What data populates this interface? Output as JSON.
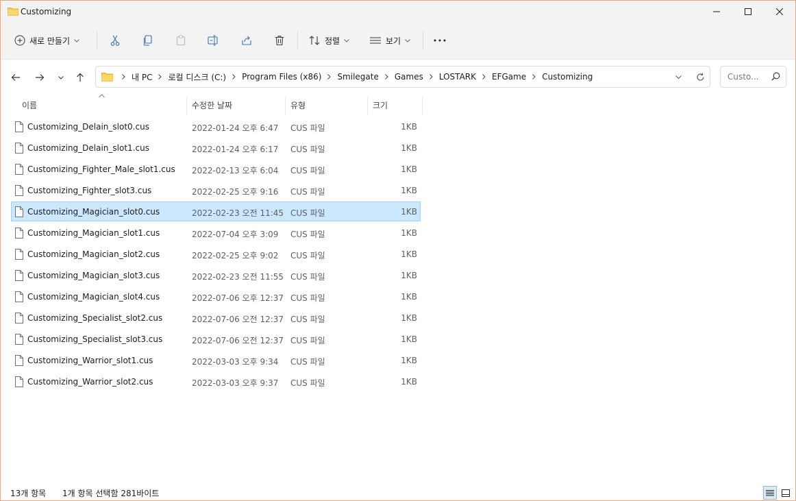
{
  "window": {
    "title": "Customizing"
  },
  "toolbar": {
    "new_label": "새로 만들기",
    "sort_label": "정렬",
    "view_label": "보기"
  },
  "breadcrumb": [
    "내 PC",
    "로컬 디스크 (C:)",
    "Program Files (x86)",
    "Smilegate",
    "Games",
    "LOSTARK",
    "EFGame",
    "Customizing"
  ],
  "search": {
    "placeholder": "Custo..."
  },
  "columns": {
    "name": "이름",
    "date": "수정한 날짜",
    "type": "유형",
    "size": "크기"
  },
  "files": [
    {
      "name": "Customizing_Delain_slot0.cus",
      "date": "2022-01-24 오후 6:47",
      "type": "CUS 파일",
      "size": "1KB",
      "selected": false
    },
    {
      "name": "Customizing_Delain_slot1.cus",
      "date": "2022-01-24 오후 6:17",
      "type": "CUS 파일",
      "size": "1KB",
      "selected": false
    },
    {
      "name": "Customizing_Fighter_Male_slot1.cus",
      "date": "2022-02-13 오후 6:04",
      "type": "CUS 파일",
      "size": "1KB",
      "selected": false
    },
    {
      "name": "Customizing_Fighter_slot3.cus",
      "date": "2022-02-25 오후 9:16",
      "type": "CUS 파일",
      "size": "1KB",
      "selected": false
    },
    {
      "name": "Customizing_Magician_slot0.cus",
      "date": "2022-02-23 오전 11:45",
      "type": "CUS 파일",
      "size": "1KB",
      "selected": true
    },
    {
      "name": "Customizing_Magician_slot1.cus",
      "date": "2022-07-04 오후 3:09",
      "type": "CUS 파일",
      "size": "1KB",
      "selected": false
    },
    {
      "name": "Customizing_Magician_slot2.cus",
      "date": "2022-02-25 오후 9:02",
      "type": "CUS 파일",
      "size": "1KB",
      "selected": false
    },
    {
      "name": "Customizing_Magician_slot3.cus",
      "date": "2022-02-23 오전 11:55",
      "type": "CUS 파일",
      "size": "1KB",
      "selected": false
    },
    {
      "name": "Customizing_Magician_slot4.cus",
      "date": "2022-07-06 오후 12:37",
      "type": "CUS 파일",
      "size": "1KB",
      "selected": false
    },
    {
      "name": "Customizing_Specialist_slot2.cus",
      "date": "2022-07-06 오전 12:37",
      "type": "CUS 파일",
      "size": "1KB",
      "selected": false
    },
    {
      "name": "Customizing_Specialist_slot3.cus",
      "date": "2022-07-06 오전 12:37",
      "type": "CUS 파일",
      "size": "1KB",
      "selected": false
    },
    {
      "name": "Customizing_Warrior_slot1.cus",
      "date": "2022-03-03 오후 9:34",
      "type": "CUS 파일",
      "size": "1KB",
      "selected": false
    },
    {
      "name": "Customizing_Warrior_slot2.cus",
      "date": "2022-03-03 오후 9:37",
      "type": "CUS 파일",
      "size": "1KB",
      "selected": false
    }
  ],
  "status": {
    "count": "13개 항목",
    "selection": "1개 항목 선택함 281바이트"
  },
  "colors": {
    "accent": "#0067c0",
    "selection_bg": "#cce8ff",
    "selection_border": "#99d1ff",
    "folder": "#f8c94a",
    "window_border": "#e8a87c"
  }
}
